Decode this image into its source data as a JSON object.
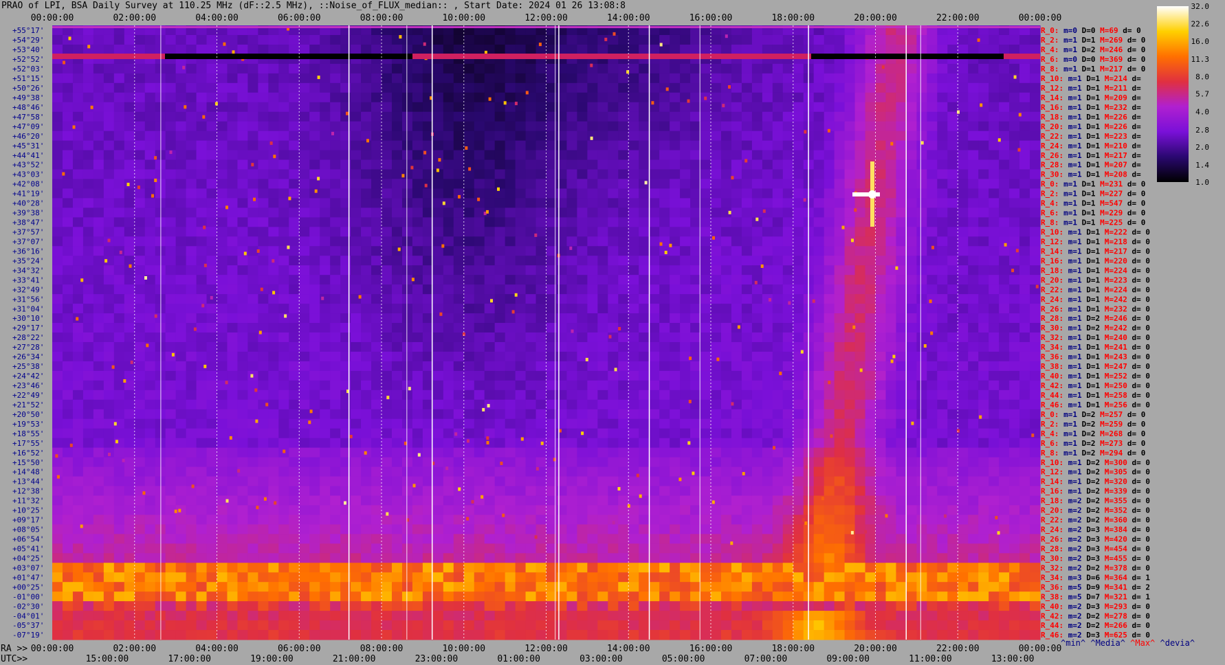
{
  "title": "PRAO of LPI, BSA Daily Survey at 110.25 MHz (dF::2.5 MHz), ::Noise_of_FLUX_median:: , Start Date: 2024 01 26 13:08:8",
  "chart_data": {
    "type": "heatmap",
    "title": "PRAO of LPI, BSA Daily Survey at 110.25 MHz (dF::2.5 MHz), ::Noise_of_FLUX_median:: , Start Date: 2024 01 26 13:08:8",
    "x_top_ticks": [
      "00:00:00",
      "02:00:00",
      "04:00:00",
      "06:00:00",
      "08:00:00",
      "10:00:00",
      "12:00:00",
      "14:00:00",
      "16:00:00",
      "18:00:00",
      "20:00:00",
      "22:00:00",
      "00:00:00"
    ],
    "ra_prefix": "RA >>",
    "ra_ticks": [
      "00:00:00",
      "02:00:00",
      "04:00:00",
      "06:00:00",
      "08:00:00",
      "10:00:00",
      "12:00:00",
      "14:00:00",
      "16:00:00",
      "18:00:00",
      "20:00:00",
      "22:00:00",
      "00:00:00"
    ],
    "utc_prefix": "UTC>>",
    "utc_ticks": [
      "15:00:00",
      "17:00:00",
      "19:00:00",
      "21:00:00",
      "23:00:00",
      "01:00:00",
      "03:00:00",
      "05:00:00",
      "07:00:00",
      "09:00:00",
      "11:00:00",
      "13:00:00"
    ],
    "dec_labels": [
      "+55°17'",
      "+54°29'",
      "+53°40'",
      "+52°52'",
      "+52°03'",
      "+51°15'",
      "+50°26'",
      "+49°38'",
      "+48°46'",
      "+47°58'",
      "+47°09'",
      "+46°20'",
      "+45°31'",
      "+44°41'",
      "+43°52'",
      "+43°03'",
      "+42°08'",
      "+41°19'",
      "+40°28'",
      "+39°38'",
      "+38°47'",
      "+37°57'",
      "+37°07'",
      "+36°16'",
      "+35°24'",
      "+34°32'",
      "+33°41'",
      "+32°49'",
      "+31°56'",
      "+31°04'",
      "+30°10'",
      "+29°17'",
      "+28°22'",
      "+27°28'",
      "+26°34'",
      "+25°38'",
      "+24°42'",
      "+23°46'",
      "+22°49'",
      "+21°52'",
      "+20°50'",
      "+19°53'",
      "+18°55'",
      "+17°55'",
      "+16°52'",
      "+15°50'",
      "+14°48'",
      "+13°44'",
      "+12°38'",
      "+11°32'",
      "+10°25'",
      "+09°17'",
      "+08°05'",
      "+06°54'",
      "+05°41'",
      "+04°25'",
      "+03°07'",
      "+01°47'",
      "+00°25'",
      "-01°00'",
      "-02°30'",
      "-04°01'",
      "-05°37'",
      "-07°19'"
    ],
    "colorbar_ticks": [
      "32.0",
      "22.6",
      "16.0",
      "11.3",
      "8.0",
      "5.7",
      "4.0",
      "2.8",
      "2.0",
      "1.4",
      "1.0"
    ],
    "colorbar_range": [
      1.0,
      32.0
    ],
    "colormap": [
      "#000000",
      "#2a0870",
      "#7a10d8",
      "#b020d0",
      "#e03040",
      "#ff7000",
      "#ffd000",
      "#ffffff"
    ],
    "beam_stats": [
      {
        "r": "R_0:",
        "m": "m=0",
        "d": "D=0",
        "M": "M=69",
        "dev": "d= 0"
      },
      {
        "r": "R_2:",
        "m": "m=1",
        "d": "D=1",
        "M": "M=269",
        "dev": "d= 0"
      },
      {
        "r": "R_4:",
        "m": "m=1",
        "d": "D=2",
        "M": "M=246",
        "dev": "d= 0"
      },
      {
        "r": "R_6:",
        "m": "m=0",
        "d": "D=0",
        "M": "M=369",
        "dev": "d= 0"
      },
      {
        "r": "R_8:",
        "m": "m=1",
        "d": "D=1",
        "M": "M=217",
        "dev": "d= 0"
      },
      {
        "r": "R_10:",
        "m": "m=1",
        "d": "D=1",
        "M": "M=214",
        "dev": "d="
      },
      {
        "r": "R_12:",
        "m": "m=1",
        "d": "D=1",
        "M": "M=211",
        "dev": "d="
      },
      {
        "r": "R_14:",
        "m": "m=1",
        "d": "D=1",
        "M": "M=209",
        "dev": "d="
      },
      {
        "r": "R_16:",
        "m": "m=1",
        "d": "D=1",
        "M": "M=232",
        "dev": "d="
      },
      {
        "r": "R_18:",
        "m": "m=1",
        "d": "D=1",
        "M": "M=226",
        "dev": "d="
      },
      {
        "r": "R_20:",
        "m": "m=1",
        "d": "D=1",
        "M": "M=226",
        "dev": "d="
      },
      {
        "r": "R_22:",
        "m": "m=1",
        "d": "D=1",
        "M": "M=223",
        "dev": "d="
      },
      {
        "r": "R_24:",
        "m": "m=1",
        "d": "D=1",
        "M": "M=210",
        "dev": "d="
      },
      {
        "r": "R_26:",
        "m": "m=1",
        "d": "D=1",
        "M": "M=217",
        "dev": "d="
      },
      {
        "r": "R_28:",
        "m": "m=1",
        "d": "D=1",
        "M": "M=207",
        "dev": "d="
      },
      {
        "r": "R_30:",
        "m": "m=1",
        "d": "D=1",
        "M": "M=208",
        "dev": "d="
      },
      {
        "r": "R_0:",
        "m": "m=1",
        "d": "D=1",
        "M": "M=231",
        "dev": "d= 0"
      },
      {
        "r": "R_2:",
        "m": "m=1",
        "d": "D=1",
        "M": "M=227",
        "dev": "d= 0"
      },
      {
        "r": "R_4:",
        "m": "m=1",
        "d": "D=1",
        "M": "M=547",
        "dev": "d= 0"
      },
      {
        "r": "R_6:",
        "m": "m=1",
        "d": "D=1",
        "M": "M=229",
        "dev": "d= 0"
      },
      {
        "r": "R_8:",
        "m": "m=1",
        "d": "D=1",
        "M": "M=225",
        "dev": "d= 0"
      },
      {
        "r": "R_10:",
        "m": "m=1",
        "d": "D=1",
        "M": "M=222",
        "dev": "d= 0"
      },
      {
        "r": "R_12:",
        "m": "m=1",
        "d": "D=1",
        "M": "M=218",
        "dev": "d= 0"
      },
      {
        "r": "R_14:",
        "m": "m=1",
        "d": "D=1",
        "M": "M=217",
        "dev": "d= 0"
      },
      {
        "r": "R_16:",
        "m": "m=1",
        "d": "D=1",
        "M": "M=220",
        "dev": "d= 0"
      },
      {
        "r": "R_18:",
        "m": "m=1",
        "d": "D=1",
        "M": "M=224",
        "dev": "d= 0"
      },
      {
        "r": "R_20:",
        "m": "m=1",
        "d": "D=1",
        "M": "M=223",
        "dev": "d= 0"
      },
      {
        "r": "R_22:",
        "m": "m=1",
        "d": "D=1",
        "M": "M=224",
        "dev": "d= 0"
      },
      {
        "r": "R_24:",
        "m": "m=1",
        "d": "D=1",
        "M": "M=242",
        "dev": "d= 0"
      },
      {
        "r": "R_26:",
        "m": "m=1",
        "d": "D=1",
        "M": "M=232",
        "dev": "d= 0"
      },
      {
        "r": "R_28:",
        "m": "m=1",
        "d": "D=2",
        "M": "M=246",
        "dev": "d= 0"
      },
      {
        "r": "R_30:",
        "m": "m=1",
        "d": "D=2",
        "M": "M=242",
        "dev": "d= 0"
      },
      {
        "r": "R_32:",
        "m": "m=1",
        "d": "D=1",
        "M": "M=240",
        "dev": "d= 0"
      },
      {
        "r": "R_34:",
        "m": "m=1",
        "d": "D=1",
        "M": "M=241",
        "dev": "d= 0"
      },
      {
        "r": "R_36:",
        "m": "m=1",
        "d": "D=1",
        "M": "M=243",
        "dev": "d= 0"
      },
      {
        "r": "R_38:",
        "m": "m=1",
        "d": "D=1",
        "M": "M=247",
        "dev": "d= 0"
      },
      {
        "r": "R_40:",
        "m": "m=1",
        "d": "D=1",
        "M": "M=252",
        "dev": "d= 0"
      },
      {
        "r": "R_42:",
        "m": "m=1",
        "d": "D=1",
        "M": "M=250",
        "dev": "d= 0"
      },
      {
        "r": "R_44:",
        "m": "m=1",
        "d": "D=1",
        "M": "M=258",
        "dev": "d= 0"
      },
      {
        "r": "R_46:",
        "m": "m=1",
        "d": "D=1",
        "M": "M=256",
        "dev": "d= 0"
      },
      {
        "r": "R_0:",
        "m": "m=1",
        "d": "D=2",
        "M": "M=257",
        "dev": "d= 0"
      },
      {
        "r": "R_2:",
        "m": "m=1",
        "d": "D=2",
        "M": "M=259",
        "dev": "d= 0"
      },
      {
        "r": "R_4:",
        "m": "m=1",
        "d": "D=2",
        "M": "M=268",
        "dev": "d= 0"
      },
      {
        "r": "R_6:",
        "m": "m=1",
        "d": "D=2",
        "M": "M=273",
        "dev": "d= 0"
      },
      {
        "r": "R_8:",
        "m": "m=1",
        "d": "D=2",
        "M": "M=294",
        "dev": "d= 0"
      },
      {
        "r": "R_10:",
        "m": "m=1",
        "d": "D=2",
        "M": "M=300",
        "dev": "d= 0"
      },
      {
        "r": "R_12:",
        "m": "m=1",
        "d": "D=2",
        "M": "M=305",
        "dev": "d= 0"
      },
      {
        "r": "R_14:",
        "m": "m=1",
        "d": "D=2",
        "M": "M=320",
        "dev": "d= 0"
      },
      {
        "r": "R_16:",
        "m": "m=1",
        "d": "D=2",
        "M": "M=339",
        "dev": "d= 0"
      },
      {
        "r": "R_18:",
        "m": "m=2",
        "d": "D=2",
        "M": "M=355",
        "dev": "d= 0"
      },
      {
        "r": "R_20:",
        "m": "m=2",
        "d": "D=2",
        "M": "M=352",
        "dev": "d= 0"
      },
      {
        "r": "R_22:",
        "m": "m=2",
        "d": "D=2",
        "M": "M=360",
        "dev": "d= 0"
      },
      {
        "r": "R_24:",
        "m": "m=2",
        "d": "D=3",
        "M": "M=384",
        "dev": "d= 0"
      },
      {
        "r": "R_26:",
        "m": "m=2",
        "d": "D=3",
        "M": "M=420",
        "dev": "d= 0"
      },
      {
        "r": "R_28:",
        "m": "m=2",
        "d": "D=3",
        "M": "M=454",
        "dev": "d= 0"
      },
      {
        "r": "R_30:",
        "m": "m=2",
        "d": "D=3",
        "M": "M=455",
        "dev": "d= 0"
      },
      {
        "r": "R_32:",
        "m": "m=2",
        "d": "D=2",
        "M": "M=378",
        "dev": "d= 0"
      },
      {
        "r": "R_34:",
        "m": "m=3",
        "d": "D=6",
        "M": "M=364",
        "dev": "d= 1"
      },
      {
        "r": "R_36:",
        "m": "m=5",
        "d": "D=9",
        "M": "M=341",
        "dev": "d= 2"
      },
      {
        "r": "R_38:",
        "m": "m=5",
        "d": "D=7",
        "M": "M=321",
        "dev": "d= 1"
      },
      {
        "r": "R_40:",
        "m": "m=2",
        "d": "D=3",
        "M": "M=293",
        "dev": "d= 0"
      },
      {
        "r": "R_42:",
        "m": "m=2",
        "d": "D=2",
        "M": "M=278",
        "dev": "d= 0"
      },
      {
        "r": "R_44:",
        "m": "m=2",
        "d": "D=2",
        "M": "M=266",
        "dev": "d= 0"
      },
      {
        "r": "R_46:",
        "m": "m=2",
        "d": "D=3",
        "M": "M=625",
        "dev": "d= 0"
      }
    ],
    "stats_legend": [
      {
        "text": "^min^",
        "color": "#000080"
      },
      {
        "text": "^Media^",
        "color": "#000080"
      },
      {
        "text": "^Max^",
        "color": "#ff0000"
      },
      {
        "text": "^devia^",
        "color": "#000080"
      }
    ]
  }
}
